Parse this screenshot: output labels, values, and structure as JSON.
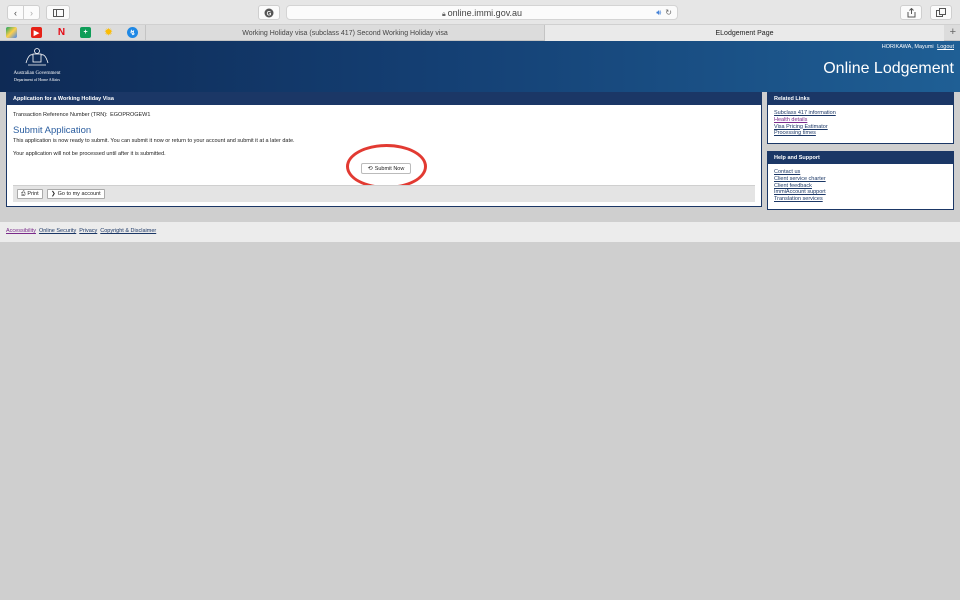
{
  "browser": {
    "url": "online.immi.gov.au",
    "tabs": [
      {
        "title": "Working Holiday visa (subclass 417) Second Working Holiday visa",
        "active": false
      },
      {
        "title": "ELodgement Page",
        "active": true
      }
    ],
    "new_tab_label": "+",
    "favicons": [
      "drive-icon",
      "youtube-icon",
      "netflix-icon",
      "sheets-icon",
      "photos-icon",
      "messenger-icon"
    ]
  },
  "header": {
    "user_name": "HORIKAWA, Mayumi",
    "logout_label": "Logout",
    "gov_name_line1": "Australian Government",
    "gov_name_line2": "Department of Home Affairs",
    "app_title": "Online Lodgement"
  },
  "main": {
    "panel_title": "Application for a Working Holiday Visa",
    "trn_label": "Transaction Reference Number (TRN):",
    "trn_value": "EGOPROGEW1",
    "section_title": "Submit Application",
    "message_ready": "This application is now ready to submit. You can submit it now or return to your account and submit it at a later date.",
    "message_not_processed": "Your application will not be processed until after it is submitted.",
    "submit_label": "Submit Now",
    "print_label": "Print",
    "account_label": "Go to my account"
  },
  "related_links": {
    "title": "Related Links",
    "items": [
      "Subclass 417 information",
      "Health details",
      "Visa Pricing Estimator",
      "Processing times"
    ]
  },
  "help_support": {
    "title": "Help and Support",
    "items": [
      "Contact us",
      "Client service charter",
      "Client feedback",
      "ImmiAccount support",
      "Translation services"
    ]
  },
  "footer": {
    "links": [
      "Accessibility",
      "Online Security",
      "Privacy",
      "Copyright & Disclaimer"
    ]
  },
  "colors": {
    "navy": "#1b3766",
    "accent_blue": "#2a5d9f",
    "highlight_red": "#e23a32"
  }
}
